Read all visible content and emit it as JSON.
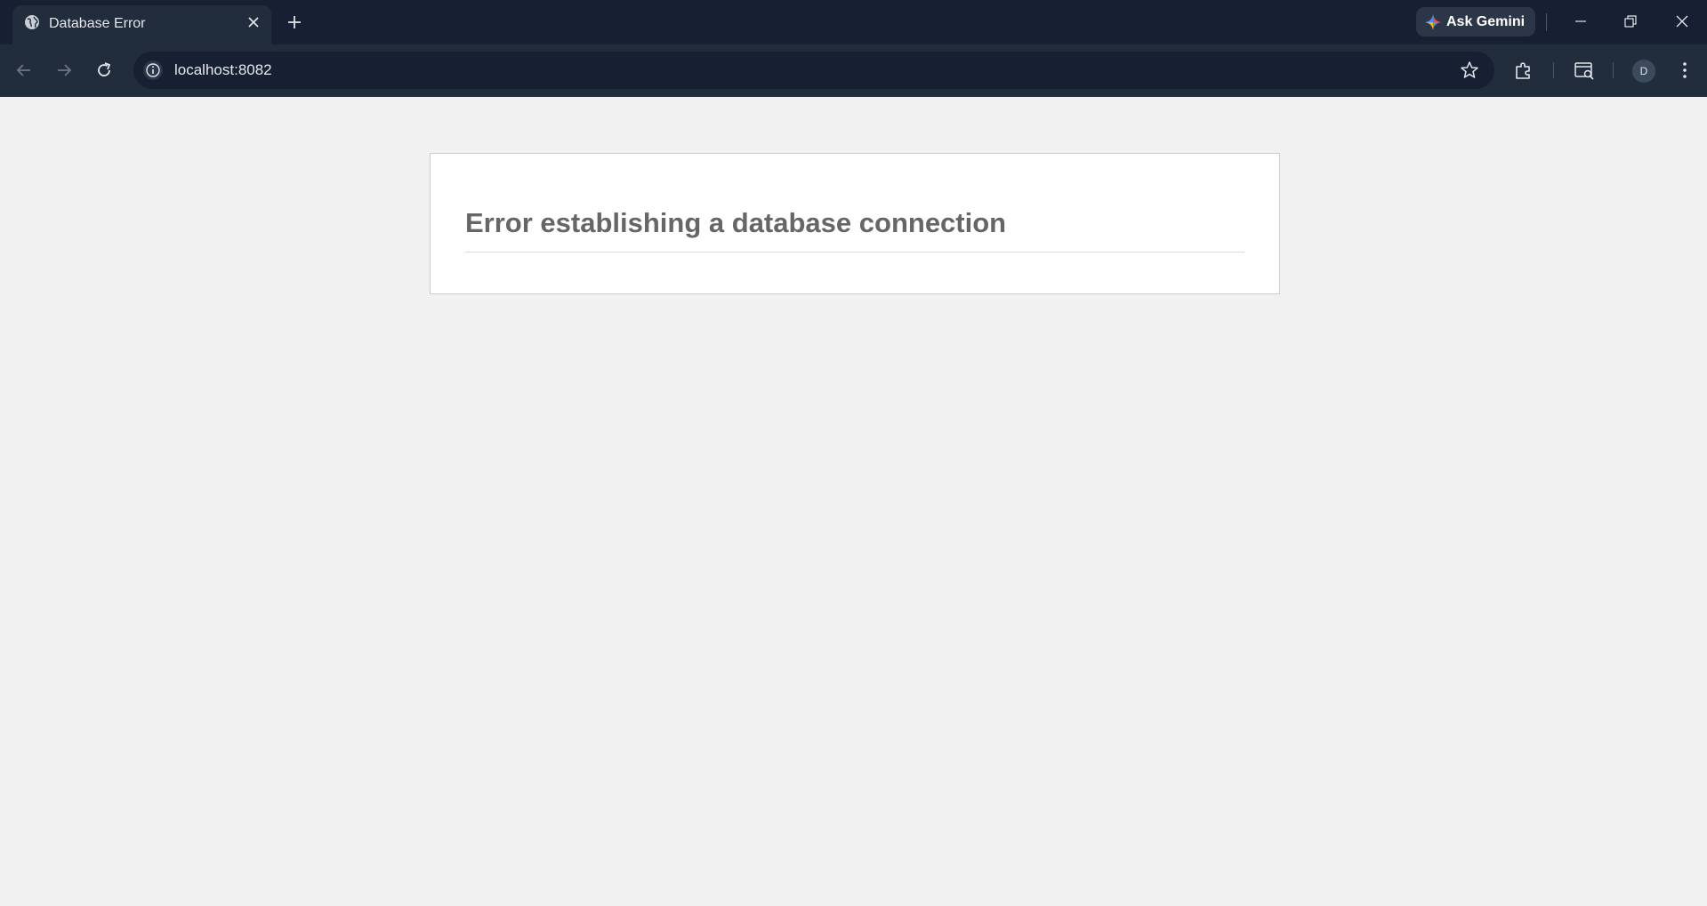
{
  "browser": {
    "tab": {
      "title": "Database Error"
    },
    "ask_gemini_label": "Ask Gemini",
    "address": "localhost:8082",
    "profile_initial": "D"
  },
  "page": {
    "error_heading": "Error establishing a database connection"
  },
  "colors": {
    "titlebar": "#162032",
    "toolbar": "#212c3d",
    "page_background": "#f1f1f1",
    "card_background": "#ffffff",
    "heading_text": "#666666"
  }
}
